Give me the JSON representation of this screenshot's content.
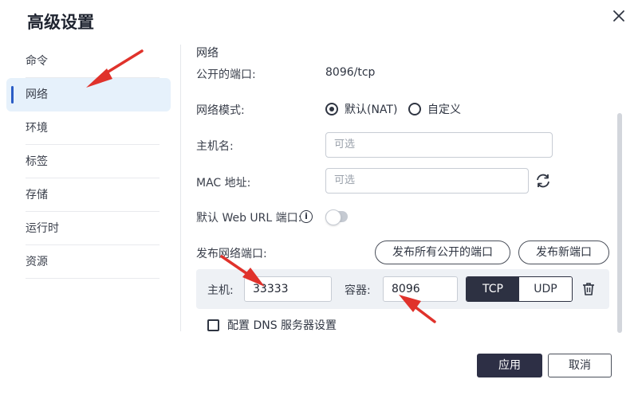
{
  "dialog": {
    "title": "高级设置"
  },
  "sidebar": {
    "items": [
      {
        "label": "命令"
      },
      {
        "label": "网络"
      },
      {
        "label": "环境"
      },
      {
        "label": "标签"
      },
      {
        "label": "存储"
      },
      {
        "label": "运行时"
      },
      {
        "label": "资源"
      }
    ],
    "active_index": 1
  },
  "network": {
    "section_title": "网络",
    "exposed_ports_label": "公开的端口:",
    "exposed_ports_value": "8096/tcp",
    "mode_label": "网络模式:",
    "mode_options": [
      {
        "label": "默认(NAT)",
        "checked": true
      },
      {
        "label": "自定义",
        "checked": false
      }
    ],
    "hostname_label": "主机名:",
    "hostname_placeholder": "可选",
    "mac_label": "MAC 地址:",
    "mac_placeholder": "可选",
    "web_url_label": "默认 Web URL 端口:",
    "web_url_info_icon": "i",
    "web_url_toggle_on": false,
    "publish_label": "发布网络端口:",
    "publish_all_button": "发布所有公开的端口",
    "publish_new_button": "发布新端口",
    "port_mapping": {
      "host_label": "主机:",
      "host_value": "33333",
      "container_label": "容器:",
      "container_value": "8096",
      "protocols": [
        "TCP",
        "UDP"
      ],
      "selected_protocol": "TCP"
    },
    "dns_checkbox_label": "配置 DNS 服务器设置",
    "dns_checked": false
  },
  "footer": {
    "apply_label": "应用",
    "cancel_label": "取消"
  },
  "colors": {
    "accent_dark": "#2d2f45",
    "active_item_bg": "#e6f1fb",
    "active_indicator": "#2a5cc5",
    "annotation_arrow": "#e0322b"
  }
}
